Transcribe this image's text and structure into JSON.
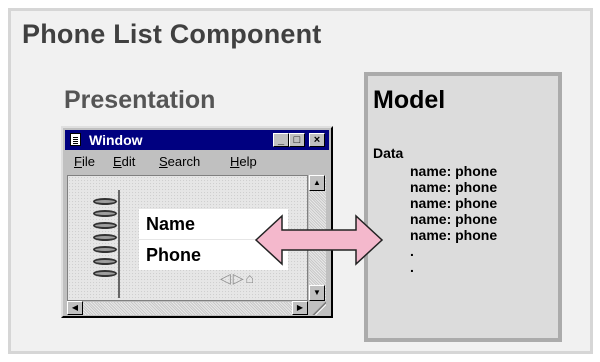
{
  "title": "Phone List Component",
  "presentation": {
    "label": "Presentation",
    "window": {
      "title": "Window",
      "buttons": {
        "minimize": "_",
        "maximize": "□",
        "close": "×"
      },
      "menu": [
        {
          "label": "File",
          "underline": "F",
          "rest": "ile"
        },
        {
          "label": "Edit",
          "underline": "E",
          "rest": "dit"
        },
        {
          "label": "Search",
          "underline": "S",
          "rest": "earch"
        },
        {
          "label": "Help",
          "underline": "H",
          "rest": "elp"
        }
      ],
      "fields": {
        "name": "Name",
        "phone": "Phone"
      },
      "nav_icons": [
        "left-arrow-icon",
        "right-arrow-icon",
        "home-icon"
      ],
      "nav_glyphs": "◁▷⌂"
    }
  },
  "model": {
    "label": "Model",
    "data_label": "Data",
    "lines": [
      "name: phone",
      "name: phone",
      "name: phone",
      "name: phone",
      "name: phone",
      ".",
      "."
    ]
  },
  "colors": {
    "titlebar": "#000080",
    "arrow_fill": "#f4b8cc",
    "model_bg": "#dcdcdc",
    "outer_bg": "#f1f1f1"
  }
}
